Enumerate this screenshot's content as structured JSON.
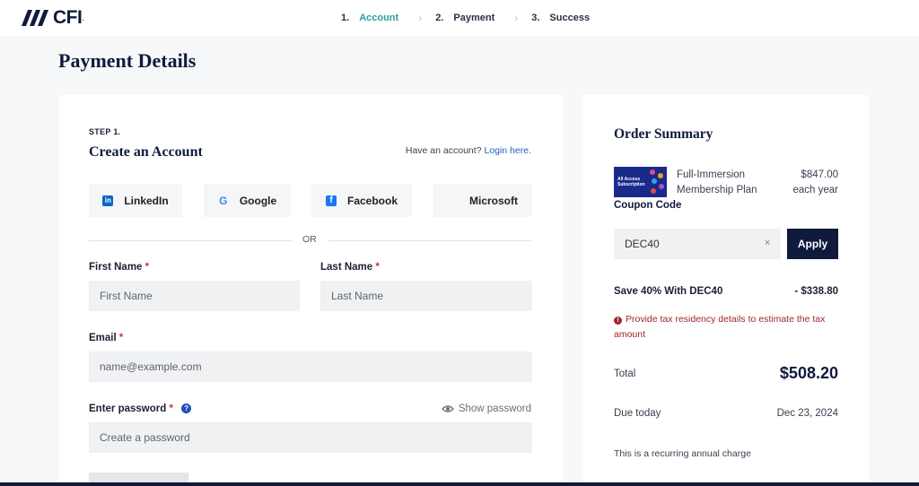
{
  "brand": {
    "name": "CFI"
  },
  "steps": [
    {
      "num": "1.",
      "label": "Account",
      "active": true
    },
    {
      "num": "2.",
      "label": "Payment",
      "active": false
    },
    {
      "num": "3.",
      "label": "Success",
      "active": false
    }
  ],
  "page": {
    "title": "Payment Details"
  },
  "form": {
    "step_label": "STEP 1.",
    "title": "Create an Account",
    "have_account": "Have an account?",
    "login_link": "Login here.",
    "social": {
      "linkedin": "LinkedIn",
      "google": "Google",
      "facebook": "Facebook",
      "microsoft": "Microsoft"
    },
    "or": "OR",
    "first_name": {
      "label": "First Name",
      "placeholder": "First Name",
      "value": ""
    },
    "last_name": {
      "label": "Last Name",
      "placeholder": "Last Name",
      "value": ""
    },
    "email": {
      "label": "Email",
      "placeholder": "name@example.com",
      "value": ""
    },
    "password": {
      "label": "Enter password",
      "placeholder": "Create a password",
      "value": "",
      "show_label": "Show password"
    },
    "required_marker": "*"
  },
  "summary": {
    "title": "Order Summary",
    "plan": {
      "name_line1": "Full-Immersion",
      "name_line2": "Membership Plan",
      "price": "$847.00",
      "period": "each year",
      "thumb_text_1": "All Access",
      "thumb_text_2": "Subscription"
    },
    "coupon": {
      "label": "Coupon Code",
      "value": "DEC40",
      "clear": "×",
      "apply": "Apply"
    },
    "discount": {
      "label": "Save 40% With DEC40",
      "amount": "- $338.80"
    },
    "tax_warning": "Provide tax residency details to estimate the tax amount",
    "total": {
      "label": "Total",
      "amount": "$508.20"
    },
    "due": {
      "label": "Due today",
      "date": "Dec 23, 2024"
    },
    "recurring_note": "This is a recurring annual charge"
  },
  "colors": {
    "brand_navy": "#0f1a3c",
    "active_step": "#2e9ea1",
    "link": "#1f63b8",
    "required": "#d0342c",
    "warning": "#a3262a"
  }
}
